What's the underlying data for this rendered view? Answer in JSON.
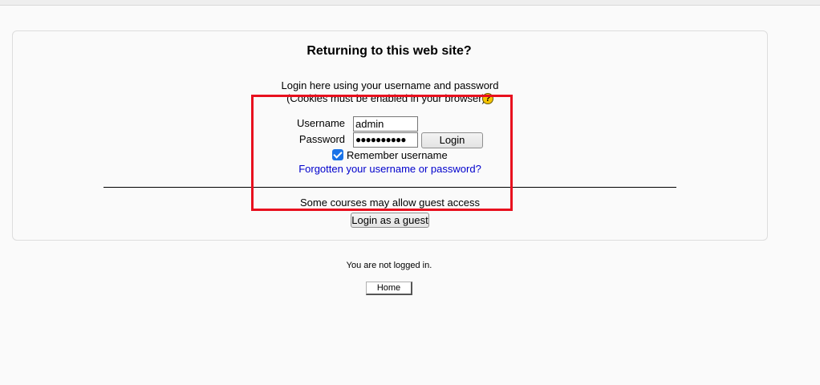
{
  "login": {
    "title": "Returning to this web site?",
    "intro_line1": "Login here using your username and password",
    "intro_line2": "(Cookies must be enabled in your browser)",
    "help_glyph": "?",
    "username_label": "Username",
    "username_value": "admin",
    "password_label": "Password",
    "password_masked": "●●●●●●●●●●",
    "login_button": "Login",
    "remember_checked": true,
    "remember_label": "Remember username",
    "forgot_link": "Forgotten your username or password?",
    "guest_text": "Some courses may allow guest access",
    "guest_button": "Login as a guest"
  },
  "footer": {
    "status": "You are not logged in.",
    "home_button": "Home"
  },
  "colors": {
    "link": "#0000cc",
    "highlight_border": "#e8101e",
    "checkbox": "#1a73e8",
    "help_icon": "#f5c400"
  },
  "icons": {
    "help": "help-icon",
    "checkbox": "checkmark"
  }
}
